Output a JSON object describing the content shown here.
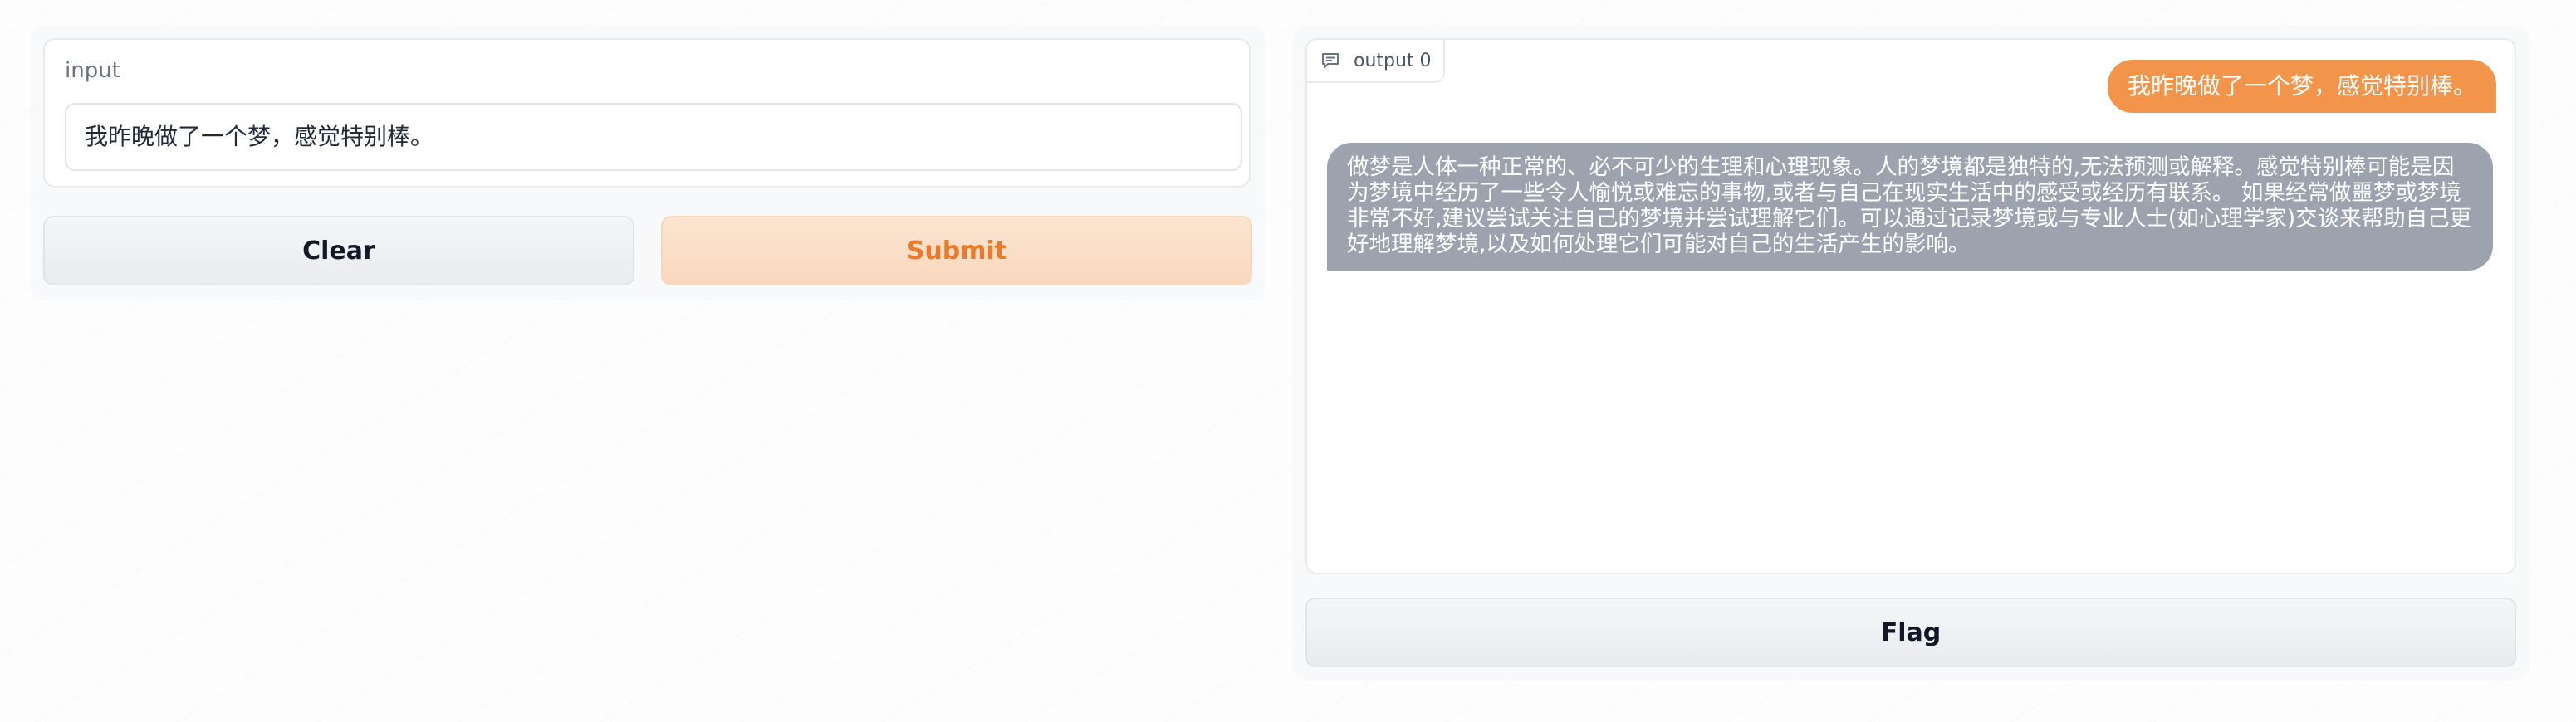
{
  "input": {
    "label": "input",
    "value": "我昨晚做了一个梦，感觉特别棒。"
  },
  "buttons": {
    "clear": "Clear",
    "submit": "Submit",
    "flag": "Flag"
  },
  "output": {
    "tab_label": "output 0",
    "tab_icon": "chat-icon",
    "messages": [
      {
        "role": "user",
        "text": "我昨晚做了一个梦，感觉特别棒。"
      },
      {
        "role": "bot",
        "text": "做梦是人体一种正常的、必不可少的生理和心理现象。人的梦境都是独特的,无法预测或解释。感觉特别棒可能是因为梦境中经历了一些令人愉悦或难忘的事物,或者与自己在现实生活中的感受或经历有联系。 如果经常做噩梦或梦境非常不好,建议尝试关注自己的梦境并尝试理解它们。可以通过记录梦境或与专业人士(如心理学家)交谈来帮助自己更好地理解梦境,以及如何处理它们可能对自己的生活产生的影响。"
      }
    ]
  },
  "colors": {
    "accent": "#f2954b",
    "submit_text": "#ea7b2c",
    "submit_bg": "#fbe4d0",
    "bot_bubble": "#9ca3af"
  }
}
